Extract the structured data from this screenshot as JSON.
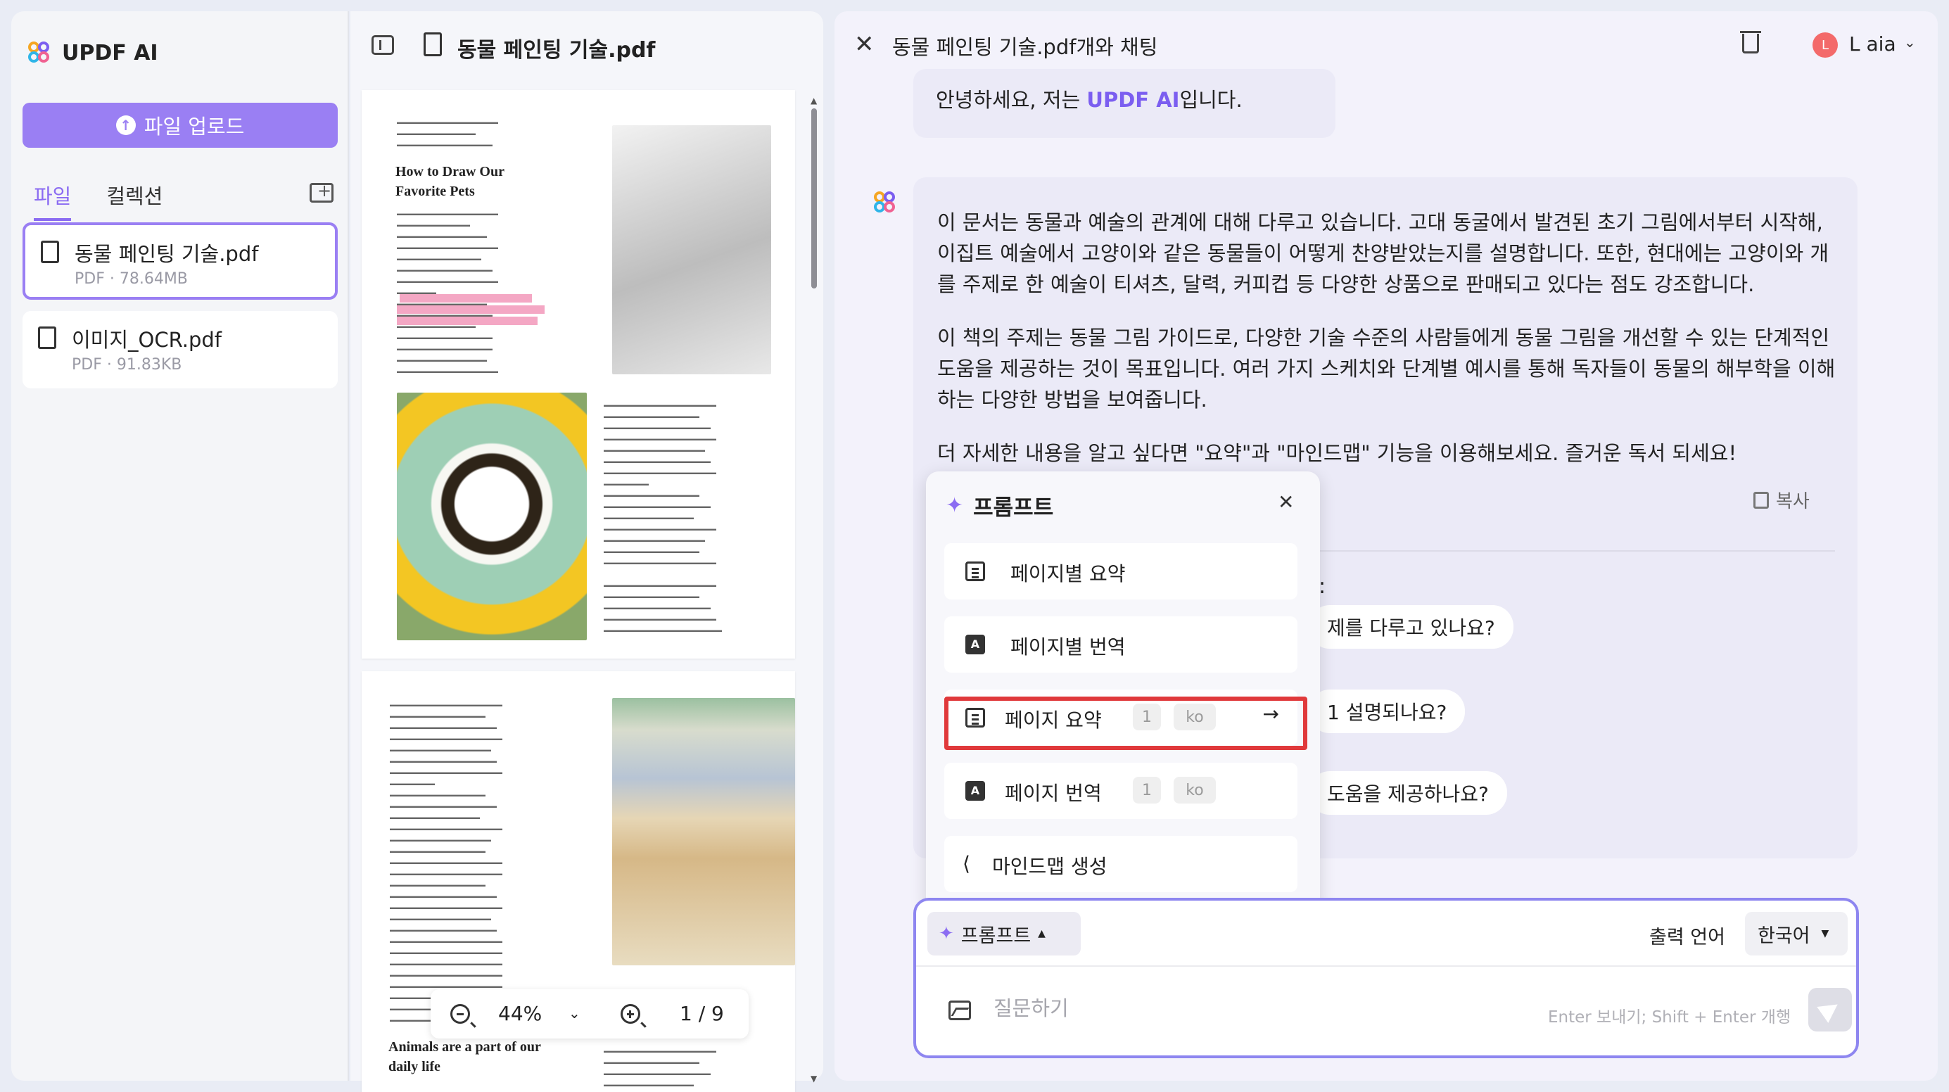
{
  "sidebar": {
    "brand": "UPDF AI",
    "upload_label": "파일 업로드",
    "tabs": [
      "파일",
      "컬렉션"
    ],
    "files": [
      {
        "name": "동물 페인팅 기술.pdf",
        "meta": "PDF · 78.64MB"
      },
      {
        "name": "이미지_OCR.pdf",
        "meta": "PDF · 91.83KB"
      }
    ]
  },
  "viewer": {
    "title": "동물 페인팅 기술.pdf",
    "page1_heading": "How to Draw Our Favorite Pets",
    "page2_heading": "Animals are a part of our daily life",
    "zoom": "44%",
    "page_indicator": "1 / 9"
  },
  "chat": {
    "title": "동물 페인팅 기술.pdf개와 채팅",
    "user_name": "L aia",
    "user_initial": "L",
    "greeting_prefix": "안녕하세요, 저는 ",
    "greeting_brand": "UPDF AI",
    "greeting_suffix": "입니다.",
    "answer_p1": "이 문서는 동물과 예술의 관계에 대해 다루고 있습니다. 고대 동굴에서 발견된 초기 그림에서부터 시작해, 이집트 예술에서 고양이와 같은 동물들이 어떻게 찬양받았는지를 설명합니다. 또한, 현대에는 고양이와 개를 주제로 한 예술이 티셔츠, 달력, 커피컵 등 다양한 상품으로 판매되고 있다는 점도 강조합니다.",
    "answer_p2": "이 책의 주제는 동물 그림 가이드로, 다양한 기술 수준의 사람들에게 동물 그림을 개선할 수 있는 단계적인 도움을 제공하는 것이 목표입니다. 여러 가지 스케치와 단계별 예시를 통해 독자들이 동물의 해부학을 이해하는 다양한 방법을 보여줍니다.",
    "answer_p3": "더 자세한 내용을 알고 싶다면 \"요약\"과 \"마인드맵\" 기능을 이용해보세요. 즐거운 독서 되세요!",
    "copy_label": "복사",
    "suggestions_colon": ":",
    "suggestions": [
      "제를 다루고 있나요?",
      "1 설명되나요?",
      "도움을 제공하나요?"
    ]
  },
  "prompt_popup": {
    "title": "프롬프트",
    "items": [
      {
        "label": "페이지별 요약"
      },
      {
        "label": "페이지별 번역"
      },
      {
        "label": "페이지 요약",
        "page": "1",
        "lang": "ko"
      },
      {
        "label": "페이지 번역",
        "page": "1",
        "lang": "ko"
      },
      {
        "label": "마인드맵 생성"
      }
    ]
  },
  "input": {
    "prompt_chip": "프롬프트",
    "output_language_label": "출력 언어",
    "output_language": "한국어",
    "placeholder": "질문하기",
    "hint": "Enter 보내기; Shift + Enter 개행"
  },
  "colors": {
    "accent": "#9a7ff3",
    "highlight_border": "#e0393b"
  }
}
